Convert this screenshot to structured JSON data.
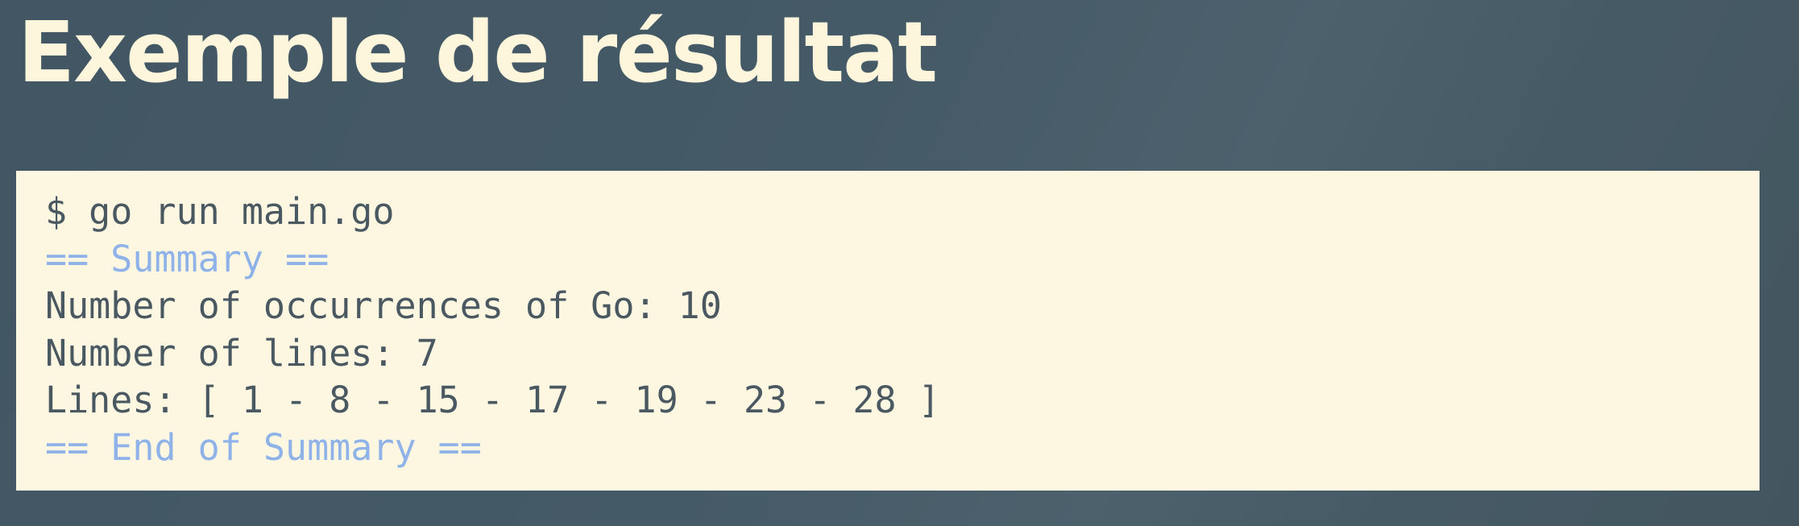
{
  "slide": {
    "title": "Exemple de résultat"
  },
  "terminal": {
    "lines": [
      {
        "text": "$ go run main.go",
        "style": "command"
      },
      {
        "text": "== Summary ==",
        "style": "highlight"
      },
      {
        "text": "Number of occurrences of Go: 10",
        "style": "output"
      },
      {
        "text": "Number of lines: 7",
        "style": "output"
      },
      {
        "text": "Lines: [ 1 - 8 - 15 - 17 - 19 - 23 - 28 ]",
        "style": "output"
      },
      {
        "text": "== End of Summary ==",
        "style": "highlight"
      }
    ]
  },
  "colors": {
    "title": "#fdf6dc",
    "code_background": "#fdf7e2",
    "code_text": "#4a5861",
    "code_highlight": "#8fb3e8",
    "slide_background": "#465a66"
  }
}
